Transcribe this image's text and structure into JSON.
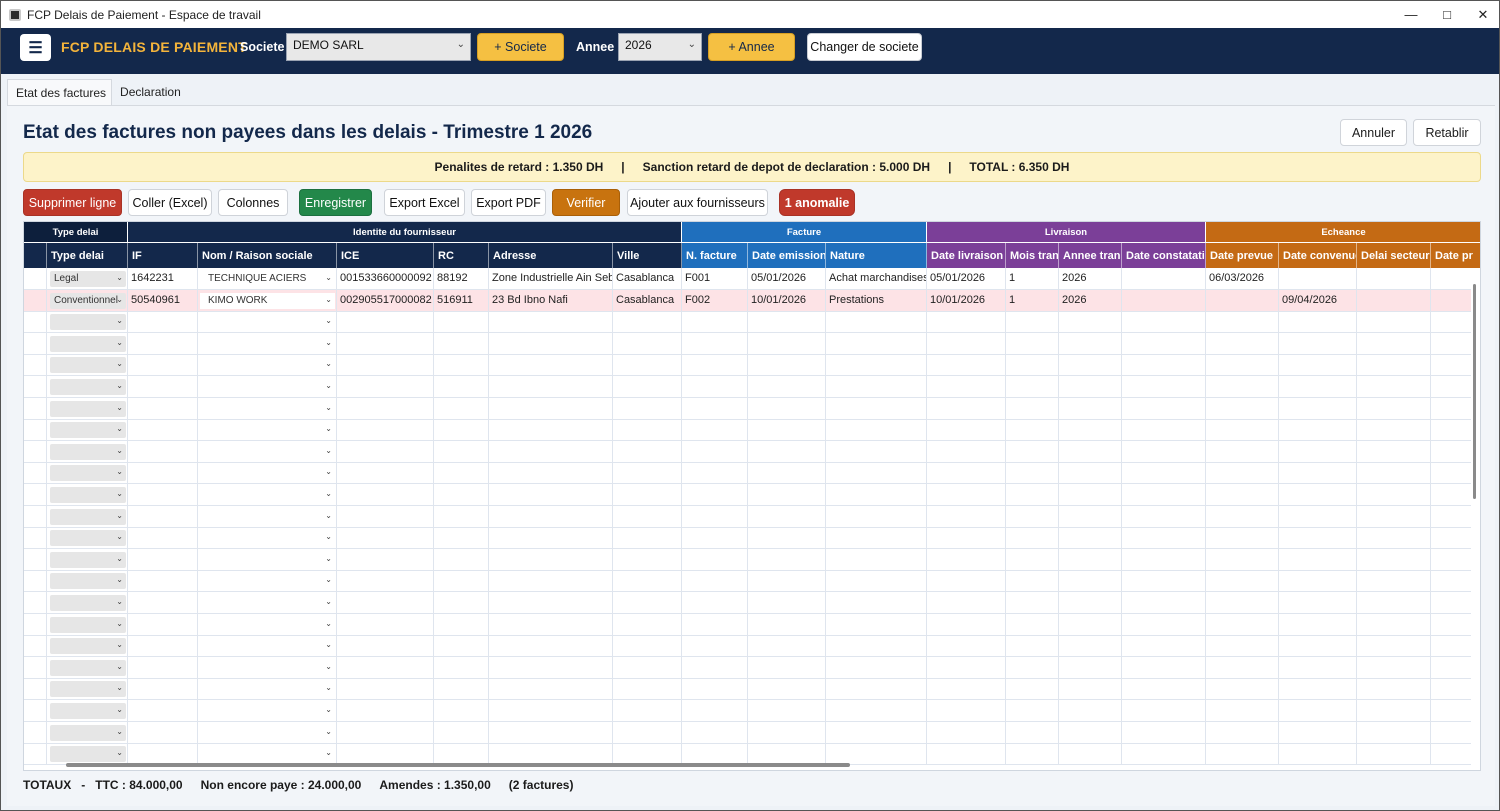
{
  "window": {
    "title": "FCP Delais de Paiement - Espace de travail",
    "controls": {
      "minimize": "—",
      "maximize": "□",
      "close": "✕"
    }
  },
  "header": {
    "menu_icon": "☰",
    "brand": "FCP DELAIS DE PAIEMENT",
    "societe_label": "Societe :",
    "societe_value": "DEMO SARL",
    "add_societe": "+ Societe",
    "annee_label": "Annee :",
    "annee_value": "2026",
    "add_annee": "+ Annee",
    "change_societe": "Changer de societe"
  },
  "tabs": [
    {
      "label": "Etat des factures",
      "active": true
    },
    {
      "label": "Declaration",
      "active": false
    }
  ],
  "page": {
    "title": "Etat des factures non payees dans les delais - Trimestre 1 2026",
    "annuler": "Annuler",
    "retablir": "Retablir"
  },
  "banner": {
    "penalites": "Penalites de retard : 1.350 DH",
    "sep1": "|",
    "sanction": "Sanction retard de depot de declaration : 5.000 DH",
    "sep2": "|",
    "total": "TOTAL : 6.350 DH"
  },
  "actions": {
    "supprimer": "Supprimer ligne",
    "coller": "Coller (Excel)",
    "colonnes": "Colonnes",
    "enregistrer": "Enregistrer",
    "export_excel": "Export Excel",
    "export_pdf": "Export PDF",
    "verifier": "Verifier",
    "ajouter_fournisseurs": "Ajouter aux fournisseurs",
    "anomalie": "1 anomalie"
  },
  "colors": {
    "navy": "#13284b",
    "blue": "#1f6fbd",
    "purple": "#7b3f98",
    "orange": "#c46a14",
    "highlight_row": "#fde3e6"
  },
  "grid": {
    "groups": {
      "type": "Type delai",
      "identite": "Identite du fournisseur",
      "facture": "Facture",
      "livraison": "Livraison",
      "echeance": "Echeance"
    },
    "columns": {
      "type_delai": "Type delai",
      "if": "IF",
      "nom": "Nom / Raison sociale",
      "ice": "ICE",
      "rc": "RC",
      "adresse": "Adresse",
      "ville": "Ville",
      "n_facture": "N. facture",
      "date_emission": "Date emission",
      "nature": "Nature",
      "date_livraison": "Date livraison",
      "mois_trans": "Mois tran",
      "annee_trans": "Annee trans",
      "date_constatation": "Date constatatio",
      "date_prevue": "Date prevue",
      "date_convenue": "Date convenue",
      "delai_secteur": "Delai secteur (",
      "date_pr": "Date pr"
    },
    "rows": [
      {
        "type_delai": "Legal",
        "if": "1642231",
        "nom": "TECHNIQUE ACIERS",
        "ice": "001533660000092",
        "rc": "88192",
        "adresse": "Zone Industrielle Ain Sebaa",
        "ville": "Casablanca",
        "n_facture": "F001",
        "date_emission": "05/01/2026",
        "nature": "Achat marchandises",
        "date_livraison": "05/01/2026",
        "mois_trans": "1",
        "annee_trans": "2026",
        "date_constatation": "",
        "date_prevue": "06/03/2026",
        "date_convenue": "",
        "delai_secteur": "",
        "date_pr": ""
      },
      {
        "type_delai": "Conventionnel",
        "if": "50540961",
        "nom": "KIMO WORK",
        "ice": "002905517000082",
        "rc": "516911",
        "adresse": "23 Bd Ibno Nafi",
        "ville": "Casablanca",
        "n_facture": "F002",
        "date_emission": "10/01/2026",
        "nature": "Prestations",
        "date_livraison": "10/01/2026",
        "mois_trans": "1",
        "annee_trans": "2026",
        "date_constatation": "",
        "date_prevue": "",
        "date_convenue": "09/04/2026",
        "delai_secteur": "",
        "date_pr": ""
      }
    ],
    "empty_rows": 21,
    "combo_chevron": "⌄"
  },
  "totals": {
    "label": "TOTAUX",
    "dash": "-",
    "ttc": "TTC : 84.000,00",
    "non_paye": "Non encore paye : 24.000,00",
    "amendes": "Amendes : 1.350,00",
    "count": "(2 factures)"
  }
}
